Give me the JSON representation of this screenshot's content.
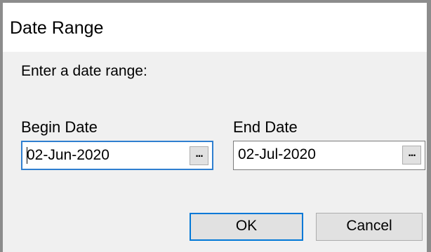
{
  "dialog": {
    "title": "Date Range",
    "prompt": "Enter a date range:"
  },
  "begin": {
    "label": "Begin Date",
    "value": "02-Jun-2020",
    "picker_label": "..."
  },
  "end": {
    "label": "End Date",
    "value": "02-Jul-2020",
    "picker_label": "..."
  },
  "buttons": {
    "ok_label": "OK",
    "cancel_label": "Cancel"
  },
  "colors": {
    "focus_border": "#2f7fd0",
    "default_button_border": "#0078d7",
    "dialog_background": "#f0f0f0"
  }
}
